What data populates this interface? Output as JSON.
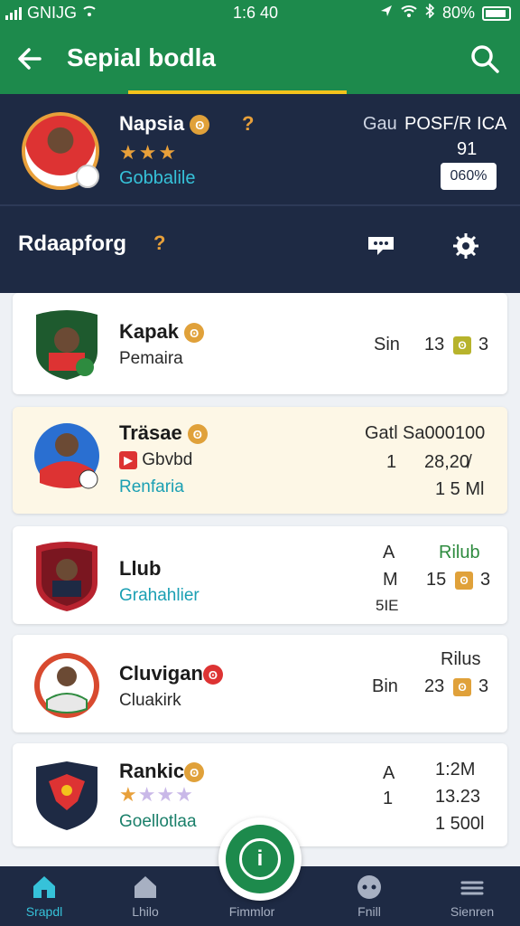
{
  "status_bar": {
    "carrier": "GNIJG",
    "time": "1:6 40",
    "battery": "80%"
  },
  "app_bar": {
    "title": "Sepial bodla"
  },
  "profile": {
    "name": "Napsia",
    "club": "Gobbalile",
    "header_1": "Gau",
    "header_2": "POSF/R ICA",
    "value": "91",
    "pill": "060%"
  },
  "section": {
    "label": "Rdaapforg"
  },
  "cards": [
    {
      "name": "Kapak",
      "sub": "Pemaira",
      "r1": "Sin",
      "r2": "13",
      "r3": "3"
    },
    {
      "name": "Träsae",
      "sub": "Gbvbd",
      "teal": "Renfaria",
      "h1": "Gatl",
      "h2": "Sa000100",
      "v1": "1",
      "v2": "28,20̸",
      "v3": "1 5 Ml"
    },
    {
      "name": "Llub",
      "teal": "Grahahlier",
      "h1": "A",
      "h2": "Rilub",
      "v1": "M",
      "v2": "15",
      "v3": "3",
      "v4": "5IE"
    },
    {
      "name": "Cluvigan",
      "sub": "Cluakirk",
      "h2": "Rilus",
      "v1": "Bin",
      "v2": "23",
      "v3": "3"
    },
    {
      "name": "Rankic",
      "teal": "Goellotlaa",
      "h1": "A",
      "v1": "1",
      "r1": "1:2M",
      "r2": "13.23",
      "r3": "1 500l"
    }
  ],
  "nav": [
    {
      "label": "Srapdl"
    },
    {
      "label": "Lhilo"
    },
    {
      "label": "Fimmlor"
    },
    {
      "label": "Fnill"
    },
    {
      "label": "Sienren"
    }
  ],
  "colors": {
    "primary": "#1d8a4c",
    "navy": "#1e2a44",
    "accent": "#e8a03a",
    "teal": "#36c2d9"
  }
}
